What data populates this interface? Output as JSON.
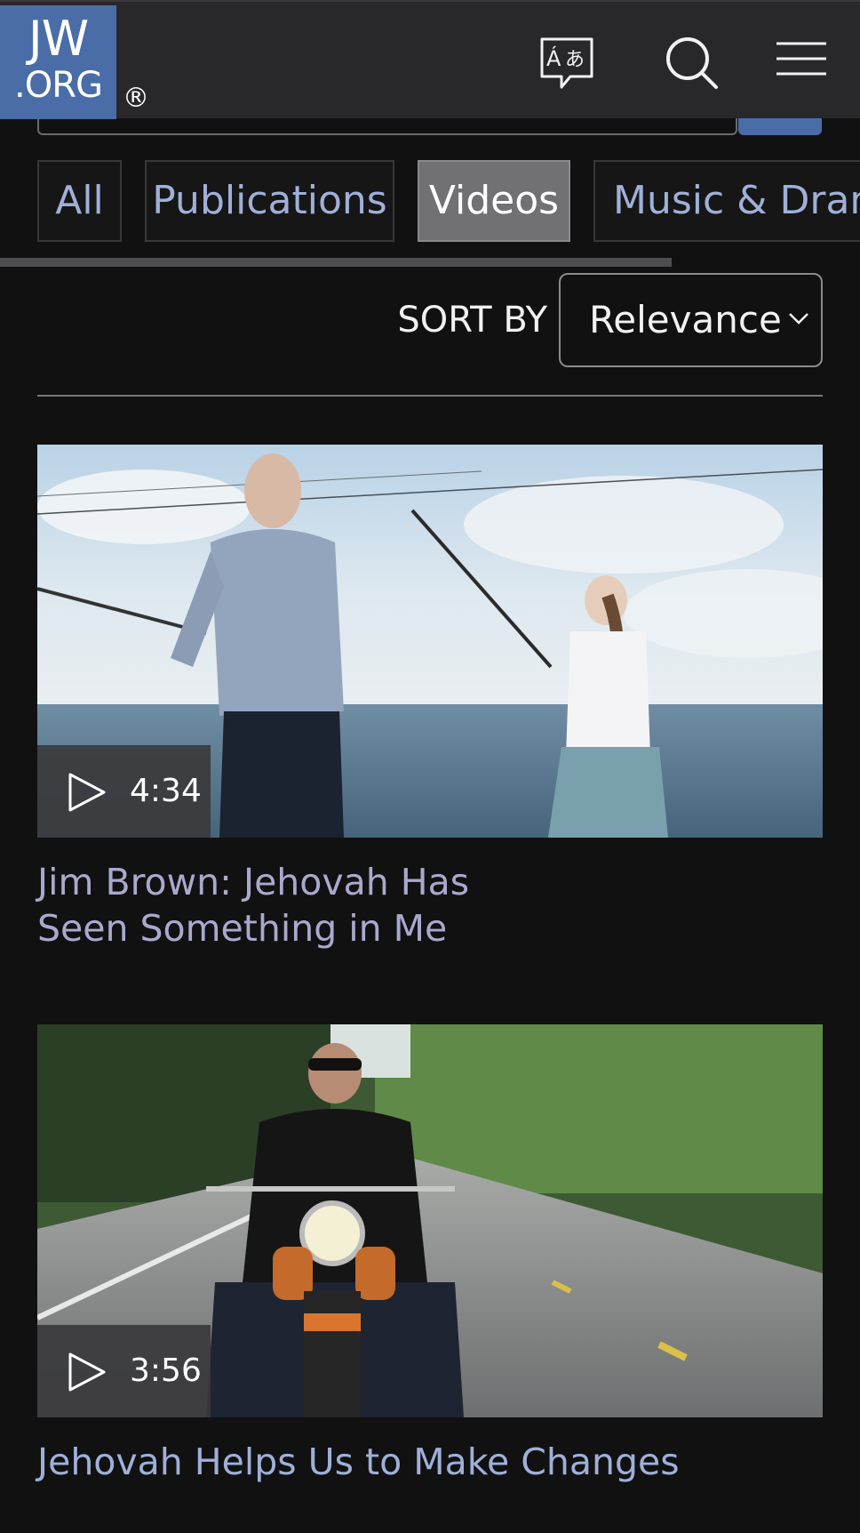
{
  "header": {
    "logo_line1": "JW",
    "logo_line2": ".ORG",
    "registered": "®",
    "icons": [
      "language-icon",
      "search-icon",
      "menu-icon"
    ]
  },
  "filters": {
    "tabs": [
      {
        "label": "All",
        "active": false
      },
      {
        "label": "Publications",
        "active": false
      },
      {
        "label": "Videos",
        "active": true
      },
      {
        "label": "Music & Drama",
        "active": false
      }
    ]
  },
  "sort": {
    "label": "SORT BY",
    "value": "Relevance"
  },
  "videos": [
    {
      "title": "Jim Brown: Jehovah Has Seen Something in Me",
      "duration": "4:34"
    },
    {
      "title": "Jehovah Helps Us to Make Changes",
      "duration": "3:56"
    }
  ],
  "colors": {
    "brand": "#4a6da7",
    "background": "#111112",
    "header": "#28282a",
    "link": "#9fb0d8",
    "active_tab": "#717173"
  }
}
